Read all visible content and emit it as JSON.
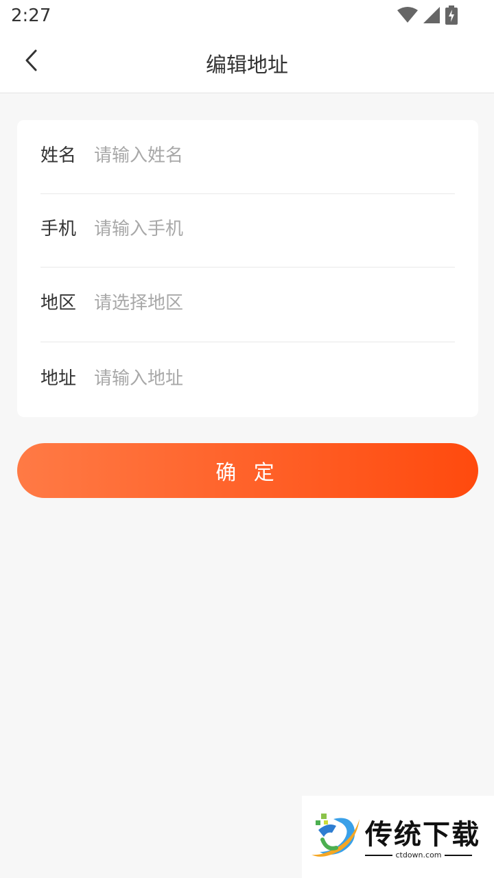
{
  "status_bar": {
    "time": "2:27",
    "icons": [
      "wifi-icon",
      "signal-icon",
      "battery-charging-icon"
    ]
  },
  "header": {
    "back_icon": "chevron-left-icon",
    "title": "编辑地址"
  },
  "form": {
    "fields": [
      {
        "label": "姓名",
        "placeholder": "请输入姓名",
        "value": ""
      },
      {
        "label": "手机",
        "placeholder": "请输入手机",
        "value": ""
      },
      {
        "label": "地区",
        "placeholder": "请选择地区",
        "value": ""
      },
      {
        "label": "地址",
        "placeholder": "请输入地址",
        "value": ""
      }
    ]
  },
  "confirm_button": {
    "label": "确 定"
  },
  "watermark": {
    "brand": "传统下载",
    "domain": "ctdown.com"
  },
  "colors": {
    "button_gradient_start": "#ff7a45",
    "button_gradient_end": "#ff4a0e",
    "background": "#f7f7f7",
    "placeholder": "#a8a8a8"
  }
}
